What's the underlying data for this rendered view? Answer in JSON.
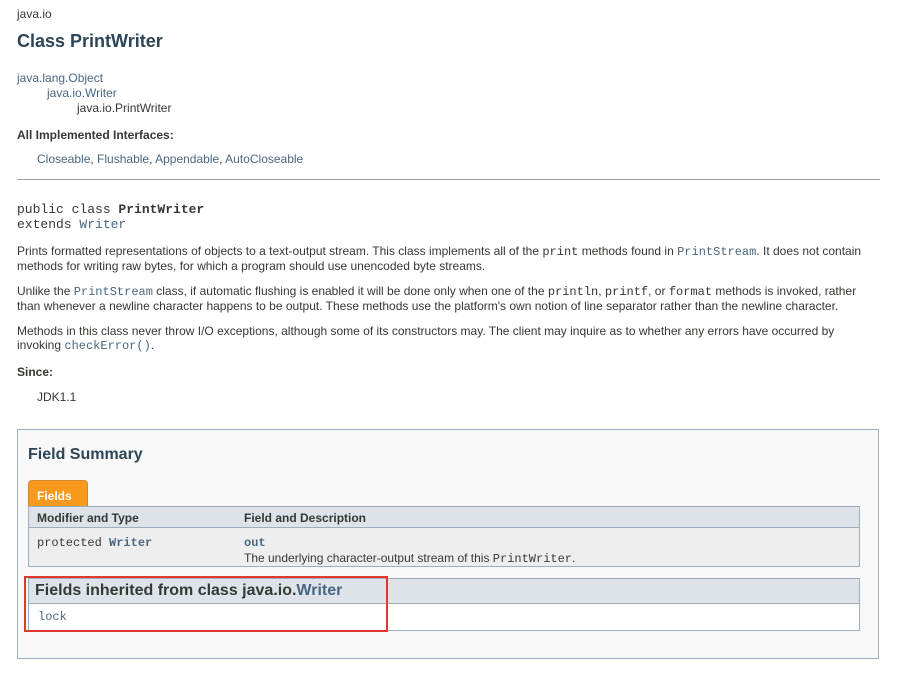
{
  "package": "java.io",
  "title": "Class PrintWriter",
  "inheritance": [
    "java.lang.Object",
    "java.io.Writer",
    "java.io.PrintWriter"
  ],
  "interfaces_heading": "All Implemented Interfaces:",
  "interfaces": [
    "Closeable",
    "Flushable",
    "Appendable",
    "AutoCloseable"
  ],
  "signature": {
    "modifiers": "public class ",
    "name": "PrintWriter",
    "extends_kw": "extends ",
    "superclass": "Writer"
  },
  "description": {
    "p1": {
      "a": "Prints formatted representations of objects to a text-output stream. This class implements all of the ",
      "code1": "print",
      "b": " methods found in ",
      "link": "PrintStream",
      "c": ". It does not contain methods for writing raw bytes, for which a program should use unencoded byte streams."
    },
    "p2": {
      "a": "Unlike the ",
      "link": "PrintStream",
      "b": " class, if automatic flushing is enabled it will be done only when one of the ",
      "code1": "println",
      "c": ", ",
      "code2": "printf",
      "d": ", or ",
      "code3": "format",
      "e": " methods is invoked, rather than whenever a newline character happens to be output. These methods use the platform's own notion of line separator rather than the newline character."
    },
    "p3": {
      "a": "Methods in this class never throw I/O exceptions, although some of its constructors may. The client may inquire as to whether any errors have occurred by invoking ",
      "link": "checkError()",
      "b": "."
    }
  },
  "since": {
    "label": "Since:",
    "value": "JDK1.1"
  },
  "field_summary": {
    "title": "Field Summary",
    "tab": "Fields",
    "columns": [
      "Modifier and Type",
      "Field and Description"
    ],
    "rows": [
      {
        "modifier": "protected ",
        "type": "Writer",
        "field": "out",
        "desc_a": "The underlying character-output stream of this ",
        "desc_code": "PrintWriter",
        "desc_b": "."
      }
    ],
    "inherited": {
      "heading": "Fields inherited from class java.io.",
      "class_link": "Writer",
      "fields": [
        "lock"
      ]
    }
  },
  "colors": {
    "link": "#4a6782",
    "tab": "#f8981d",
    "header_bg": "#dee3e9",
    "highlight": "#e03a2f"
  }
}
